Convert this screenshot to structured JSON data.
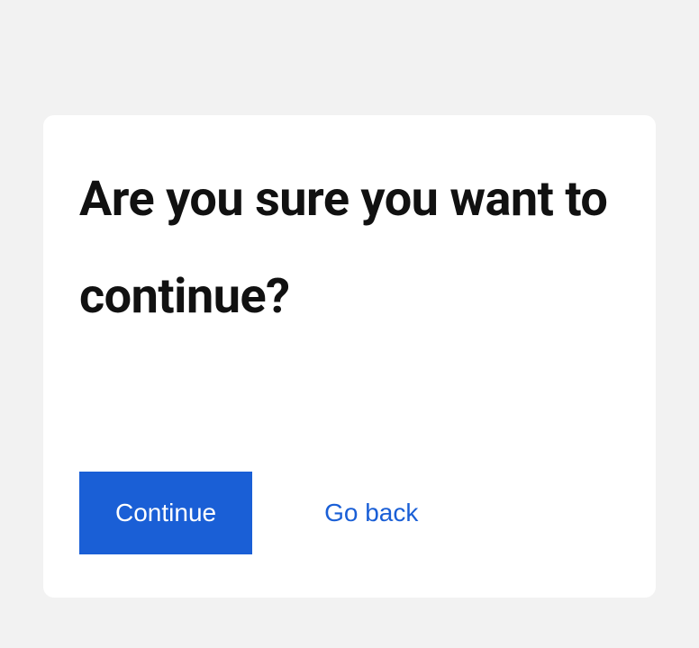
{
  "dialog": {
    "title": "Are you sure you want to continue?",
    "continue_label": "Continue",
    "go_back_label": "Go back"
  }
}
